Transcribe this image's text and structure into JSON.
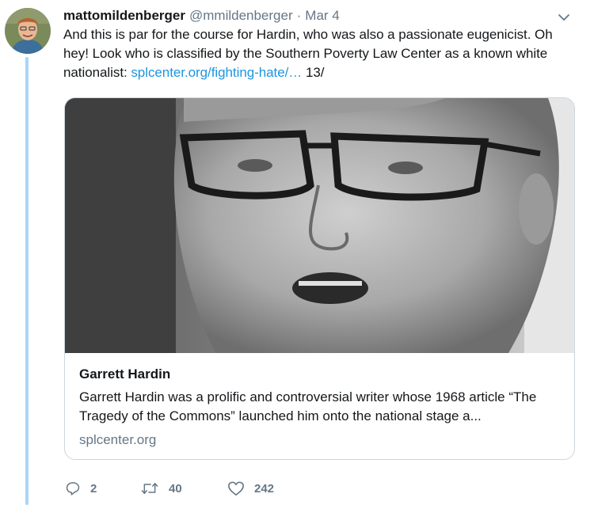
{
  "tweet": {
    "display_name": "mattomildenberger",
    "handle": "@mmildenberger",
    "separator": "·",
    "date": "Mar 4",
    "text_before_link": "And this is par for the course for Hardin, who was also a passionate eugenicist. Oh hey! Look who is classified by the Southern Poverty Law Center as a known white nationalist: ",
    "link_text": "splcenter.org/fighting-hate/…",
    "text_after_link": " 13/",
    "menu_icon": "chevron-down-icon"
  },
  "card": {
    "image_icon": "photo-portrait",
    "title": "Garrett Hardin",
    "description": "Garrett Hardin was a prolific and controversial writer whose 1968 article “The Tragedy of the Commons” launched him onto the national stage a...",
    "domain": "splcenter.org"
  },
  "actions": {
    "reply_count": "2",
    "retweet_count": "40",
    "like_count": "242"
  },
  "colors": {
    "link": "#1b95e0",
    "secondary_text": "#657786",
    "thread_line": "#a8d6f6",
    "card_border": "#ccd6dd"
  }
}
